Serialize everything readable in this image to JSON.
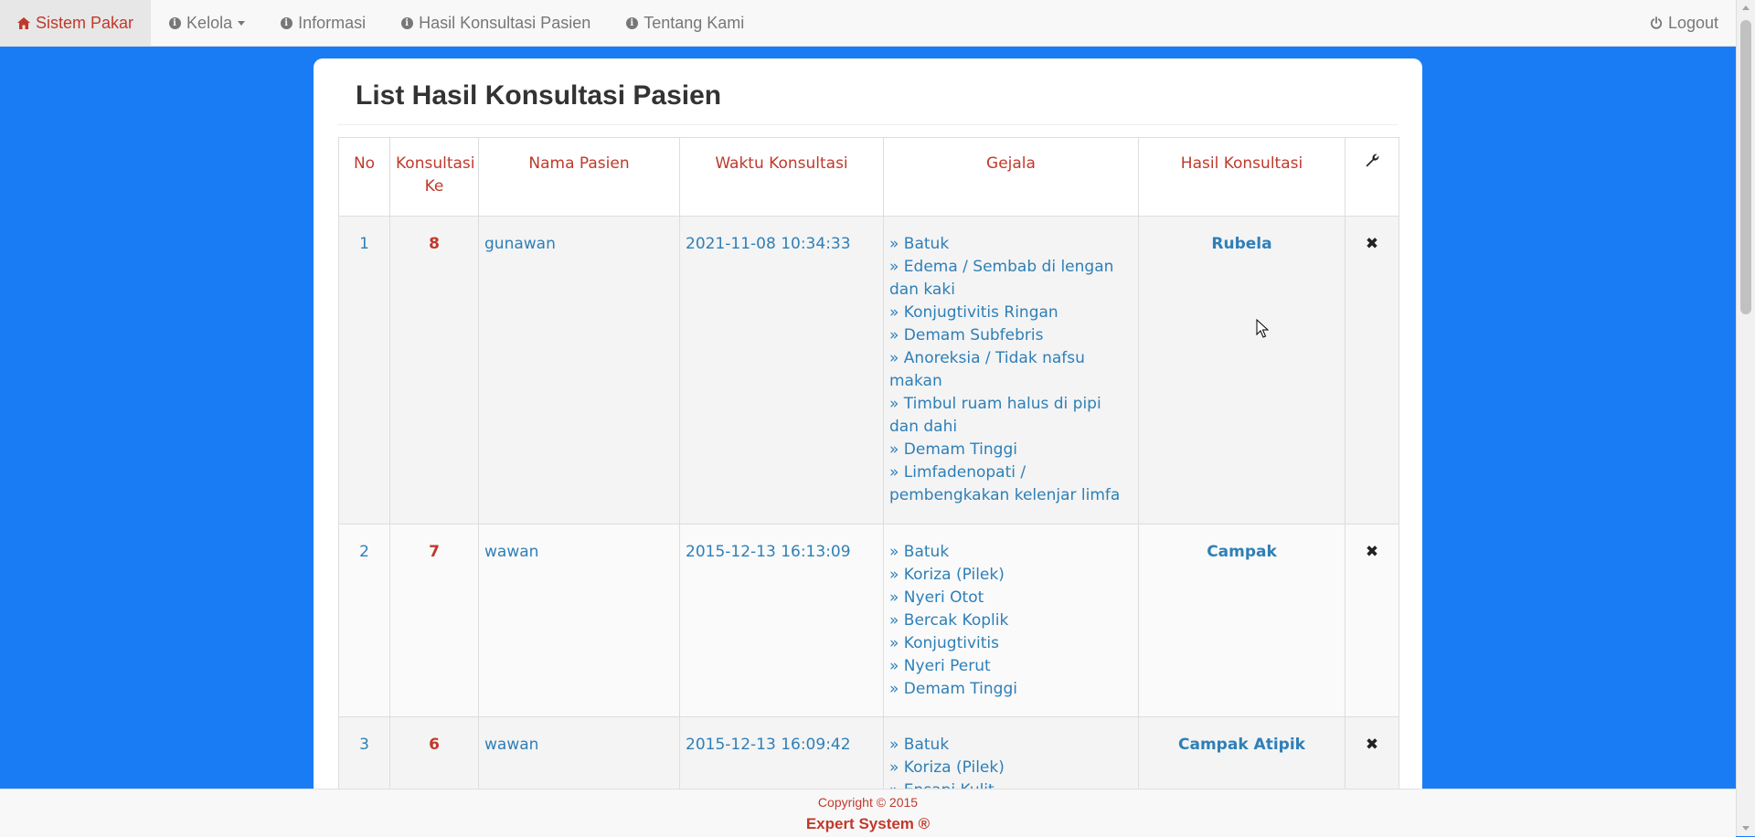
{
  "navbar": {
    "brand": "Sistem Pakar",
    "items": [
      {
        "label": "Kelola"
      },
      {
        "label": "Informasi"
      },
      {
        "label": "Hasil Konsultasi Pasien"
      },
      {
        "label": "Tentang Kami"
      }
    ],
    "logout": "Logout"
  },
  "page": {
    "title": "List Hasil Konsultasi Pasien"
  },
  "table": {
    "headers": {
      "no": "No",
      "konsultasi_ke_1": "Konsultasi",
      "konsultasi_ke_2": "Ke",
      "nama": "Nama Pasien",
      "waktu": "Waktu Konsultasi",
      "gejala": "Gejala",
      "hasil": "Hasil Konsultasi"
    },
    "rows": [
      {
        "no": "1",
        "ke": "8",
        "nama": "gunawan",
        "waktu": "2021-11-08 10:34:33",
        "gejala": [
          "» Batuk",
          "» Edema / Sembab di lengan dan kaki",
          "» Konjugtivitis Ringan",
          "» Demam Subfebris",
          "» Anoreksia / Tidak nafsu makan",
          "» Timbul ruam halus di pipi dan dahi",
          "» Demam Tinggi",
          "» Limfadenopati / pembengkakan kelenjar limfa"
        ],
        "hasil": "Rubela"
      },
      {
        "no": "2",
        "ke": "7",
        "nama": "wawan",
        "waktu": "2015-12-13 16:13:09",
        "gejala": [
          "» Batuk",
          "» Koriza (Pilek)",
          "» Nyeri Otot",
          "» Bercak Koplik",
          "» Konjugtivitis",
          "» Nyeri Perut",
          "» Demam Tinggi"
        ],
        "hasil": "Campak"
      },
      {
        "no": "3",
        "ke": "6",
        "nama": "wawan",
        "waktu": "2015-12-13 16:09:42",
        "gejala": [
          "» Batuk",
          "» Koriza (Pilek)",
          "» Ensapi Kulit"
        ],
        "hasil": "Campak Atipik"
      }
    ]
  },
  "footer": {
    "copyright": "Copyright © 2015",
    "brand": "Expert System ®"
  }
}
